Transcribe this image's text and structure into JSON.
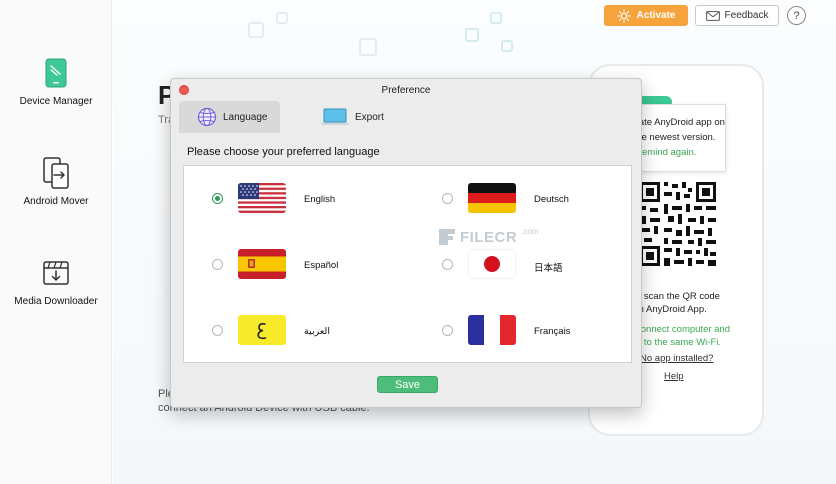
{
  "sidebar": {
    "items": [
      {
        "label": "Device Manager",
        "icon": "phone-icon"
      },
      {
        "label": "Android Mover",
        "icon": "transfer-icon"
      },
      {
        "label": "Media Downloader",
        "icon": "download-icon"
      }
    ]
  },
  "topbar": {
    "activate_label": "Activate",
    "feedback_label": "Feedback",
    "help_label": "?"
  },
  "background": {
    "title_initial": "P",
    "subtitle_start": "Tra",
    "line1_start": "Ple",
    "line2": "connect an Android Device with USB cable."
  },
  "phone_panel": {
    "popover": {
      "line1": "update AnyDroid app on",
      "line2": "to the newest version.",
      "line3": "not remind again."
    },
    "scan_line1": "e scan the QR code",
    "scan_line2": "th AnyDroid App.",
    "wifi_line1": "connect computer and",
    "wifi_line2": "e to the same Wi-Fi.",
    "no_app": "No app installed?",
    "help": "Help"
  },
  "dialog": {
    "title": "Preference",
    "tabs": [
      {
        "label": "Language",
        "active": true
      },
      {
        "label": "Export",
        "active": false
      }
    ],
    "prompt": "Please choose your preferred language",
    "languages": [
      {
        "name": "English",
        "flag": "us",
        "selected": true
      },
      {
        "name": "Deutsch",
        "flag": "de",
        "selected": false
      },
      {
        "name": "Español",
        "flag": "es",
        "selected": false
      },
      {
        "name": "日本語",
        "flag": "jp",
        "selected": false
      },
      {
        "name": "العربية",
        "flag": "ar",
        "selected": false
      },
      {
        "name": "Français",
        "flag": "fr",
        "selected": false
      }
    ],
    "save_label": "Save"
  },
  "watermark": {
    "text": "FILECR",
    "suffix": ".com"
  },
  "colors": {
    "accent_green": "#4cbd7a",
    "activate_orange": "#f5a33a",
    "close_red": "#ee5a52",
    "hint_green": "#3aa851"
  }
}
